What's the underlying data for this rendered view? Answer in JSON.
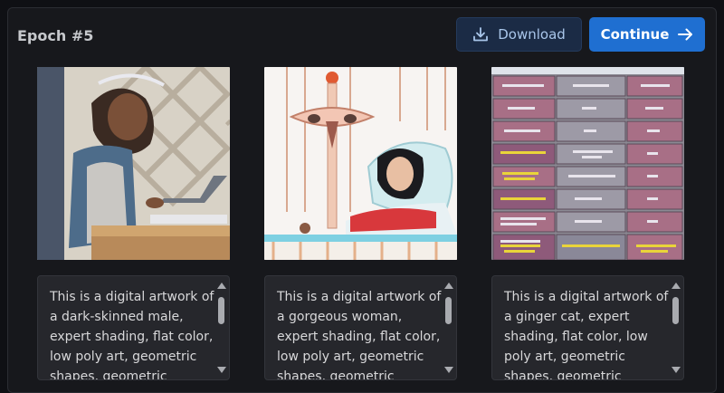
{
  "header": {
    "title": "Epoch #5",
    "download_label": "Download",
    "continue_label": "Continue"
  },
  "samples": [
    {
      "caption": "This is a digital artwork of a dark-skinned male, expert shading, flat color, low poly art, geometric shapes, geometric"
    },
    {
      "caption": "This is a digital artwork of a gorgeous woman, expert shading, flat color, low poly art, geometric shapes, geometric"
    },
    {
      "caption": "This is a digital artwork of a ginger cat, expert shading, flat color, low poly art, geometric shapes, geometric"
    }
  ],
  "colors": {
    "accent": "#1f6fd1",
    "download_bg": "#1b2b45",
    "panel_bg": "#17181c",
    "caption_bg": "#26272c"
  },
  "icons": {
    "download": "download-icon",
    "continue": "arrow-right-icon"
  }
}
